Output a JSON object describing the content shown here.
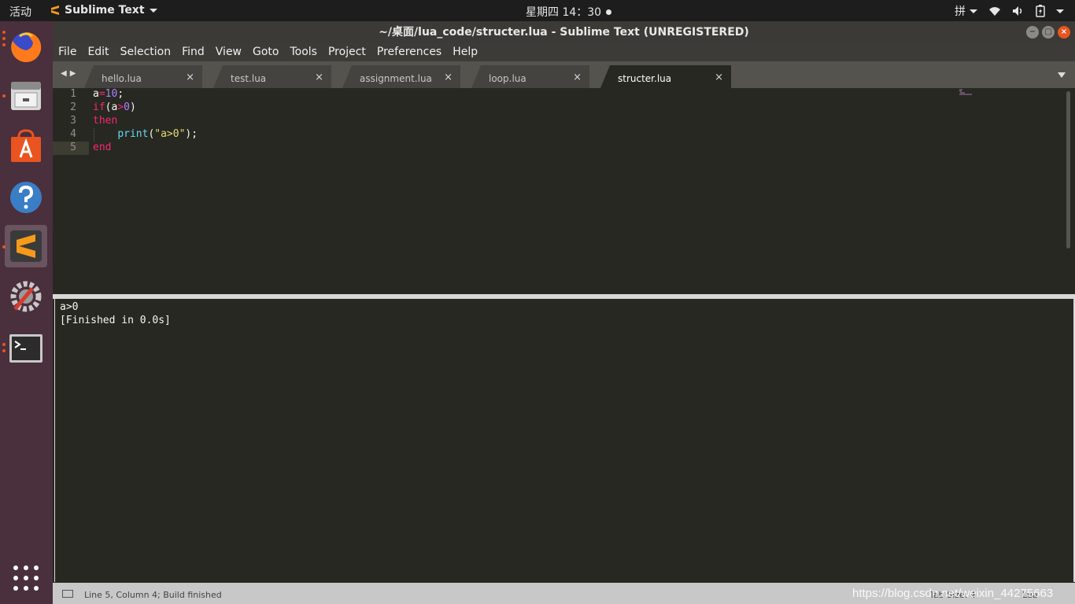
{
  "topbar": {
    "activities": "活动",
    "app_name": "Sublime Text",
    "clock": "星期四 14：30",
    "input_method": "拼"
  },
  "dock": {
    "items": [
      {
        "name": "firefox-icon"
      },
      {
        "name": "files-icon"
      },
      {
        "name": "software-center-icon"
      },
      {
        "name": "help-icon"
      },
      {
        "name": "sublime-text-icon",
        "active": true
      },
      {
        "name": "settings-icon"
      },
      {
        "name": "terminal-icon"
      }
    ]
  },
  "window": {
    "title": "~/桌面/lua_code/structer.lua - Sublime Text (UNREGISTERED)"
  },
  "menu": {
    "file": "File",
    "edit": "Edit",
    "selection": "Selection",
    "find": "Find",
    "view": "View",
    "goto": "Goto",
    "tools": "Tools",
    "project": "Project",
    "preferences": "Preferences",
    "help": "Help"
  },
  "tabs": [
    {
      "label": "hello.lua",
      "close": "×"
    },
    {
      "label": "test.lua",
      "close": "×"
    },
    {
      "label": "assignment.lua",
      "close": "×"
    },
    {
      "label": "loop.lua",
      "close": "×"
    },
    {
      "label": "structer.lua",
      "close": "×",
      "active": true
    }
  ],
  "editor": {
    "line_numbers": [
      "1",
      "2",
      "3",
      "4",
      "5"
    ],
    "current_line": "5",
    "code": {
      "l1": {
        "a": "a",
        "op": "=",
        "num": "10",
        "end": ";"
      },
      "l2": {
        "kw": "if",
        "open": "(a",
        "op": ">",
        "num": "0",
        "close": ")"
      },
      "l3": {
        "kw": "then"
      },
      "l4": {
        "indent": "    ",
        "fn": "print",
        "open": "(",
        "str": "\"a>0\"",
        "close": ");"
      },
      "l5": {
        "kw": "end"
      }
    }
  },
  "output": {
    "lines": [
      "a>0",
      "[Finished in 0.0s]"
    ]
  },
  "statusbar": {
    "text": "Line 5, Column 4; Build finished",
    "tab_size": "Tab Size: 4",
    "syntax": "Lua",
    "watermark": "https://blog.csdn.net/weixin_44275663"
  }
}
